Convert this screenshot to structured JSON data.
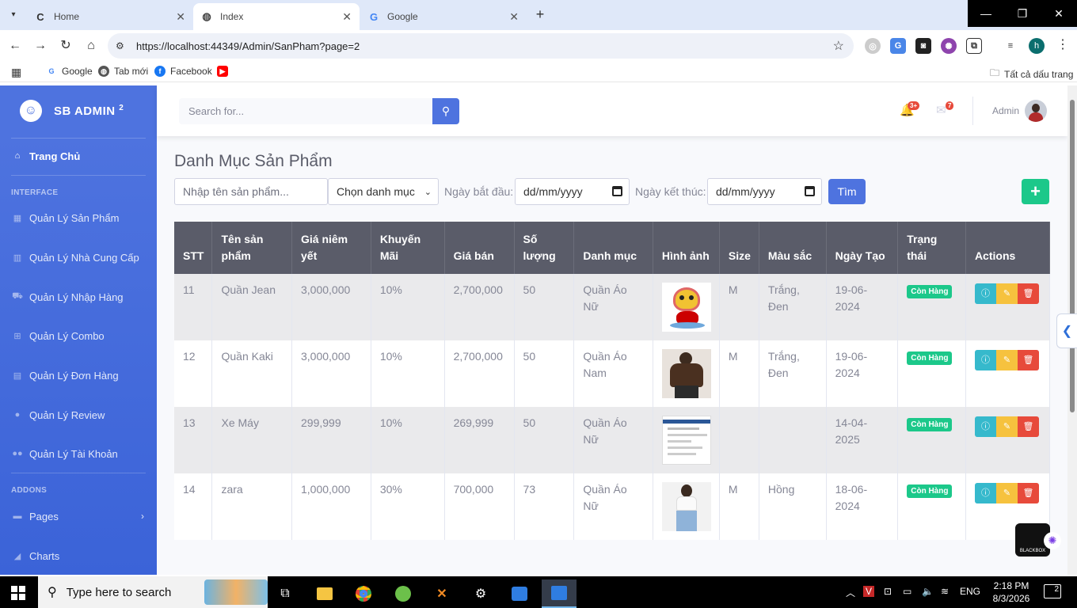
{
  "browser": {
    "tabs": [
      {
        "title": "Home",
        "favicon": "C"
      },
      {
        "title": "Index",
        "favicon": "globe"
      },
      {
        "title": "Google",
        "favicon": "G"
      }
    ],
    "url": "https://localhost:44349/Admin/SanPham?page=2",
    "bookmarks": [
      {
        "label": "Google"
      },
      {
        "label": "Tab mới"
      },
      {
        "label": "Facebook"
      },
      {
        "label": ""
      }
    ],
    "all_bookmarks_label": "Tất cả dấu trang",
    "profile_initial": "h"
  },
  "sidebar": {
    "brand": "SB ADMIN",
    "brand_sup": "2",
    "dashboard_label": "Trang Chủ",
    "heading_interface": "INTERFACE",
    "items": [
      {
        "label": "Quản Lý Sản Phẩm",
        "icon": "grid-icon"
      },
      {
        "label": "Quản Lý Nhà Cung Cấp",
        "icon": "chart-icon"
      },
      {
        "label": "Quản Lý Nhập Hàng",
        "icon": "truck-icon"
      },
      {
        "label": "Quản Lý Combo",
        "icon": "gift-icon"
      },
      {
        "label": "Quản Lý Đơn Hàng",
        "icon": "receipt-icon"
      },
      {
        "label": "Quản Lý Review",
        "icon": "comments-icon"
      },
      {
        "label": "Quản Lý Tài Khoản",
        "icon": "users-icon"
      }
    ],
    "heading_addons": "ADDONS",
    "addons": [
      {
        "label": "Pages",
        "icon": "folder-icon"
      },
      {
        "label": "Charts",
        "icon": "chart-area-icon"
      }
    ]
  },
  "topbar": {
    "search_placeholder": "Search for...",
    "alerts_count": "3+",
    "messages_count": "7",
    "user_name": "Admin"
  },
  "page": {
    "title": "Danh Mục Sản Phẩm",
    "filters": {
      "name_placeholder": "Nhập tên sản phẩm...",
      "category_selected": "Chọn danh mục",
      "start_label": "Ngày bắt đầu:",
      "start_value": "dd/mm/yyyy",
      "end_label": "Ngày kết thúc:",
      "end_value": "dd/mm/yyyy",
      "search_button": "Tìm",
      "add_button": "+"
    }
  },
  "table": {
    "columns": [
      "STT",
      "Tên sản phẩm",
      "Giá niêm yết",
      "Khuyến Mãi",
      "Giá bán",
      "Số lượng",
      "Danh mục",
      "Hình ảnh",
      "Size",
      "Màu sắc",
      "Ngày Tạo",
      "Trạng thái",
      "Actions"
    ],
    "rows": [
      {
        "stt": "11",
        "name": "Quần Jean",
        "list_price": "3,000,000",
        "discount": "10%",
        "price": "2,700,000",
        "qty": "50",
        "category": "Quần Áo Nữ",
        "image": "lion-dance-image",
        "size": "M",
        "color": "Trắng, Đen",
        "created": "19-06-2024",
        "status": "Còn Hàng"
      },
      {
        "stt": "12",
        "name": "Quần Kaki",
        "list_price": "3,000,000",
        "discount": "10%",
        "price": "2,700,000",
        "qty": "50",
        "category": "Quần Áo Nam",
        "image": "brown-jacket-image",
        "size": "M",
        "color": "Trắng, Đen",
        "created": "19-06-2024",
        "status": "Còn Hàng"
      },
      {
        "stt": "13",
        "name": "Xe Máy",
        "list_price": "299,999",
        "discount": "10%",
        "price": "269,999",
        "qty": "50",
        "category": "Quần Áo Nữ",
        "image": "screenshot-image",
        "size": "",
        "color": "",
        "created": "14-04-2025",
        "status": "Còn Hàng"
      },
      {
        "stt": "14",
        "name": "zara",
        "list_price": "1,000,000",
        "discount": "30%",
        "price": "700,000",
        "qty": "73",
        "category": "Quần Áo Nữ",
        "image": "model-jeans-image",
        "size": "M",
        "color": "Hồng",
        "created": "18-06-2024",
        "status": "Còn Hàng"
      }
    ]
  },
  "widgets": {
    "corner_label": "BLACKBOX"
  },
  "taskbar": {
    "search_placeholder": "Type here to search",
    "language": "ENG",
    "time": "2:18 PM",
    "date": "8/3/2026",
    "notifications": "2"
  },
  "colors": {
    "primary": "#4e73df",
    "success": "#1cc88a",
    "info": "#36b9cc",
    "warning": "#f6c23e",
    "danger": "#e74a3b",
    "table_header": "#5a5c69"
  }
}
